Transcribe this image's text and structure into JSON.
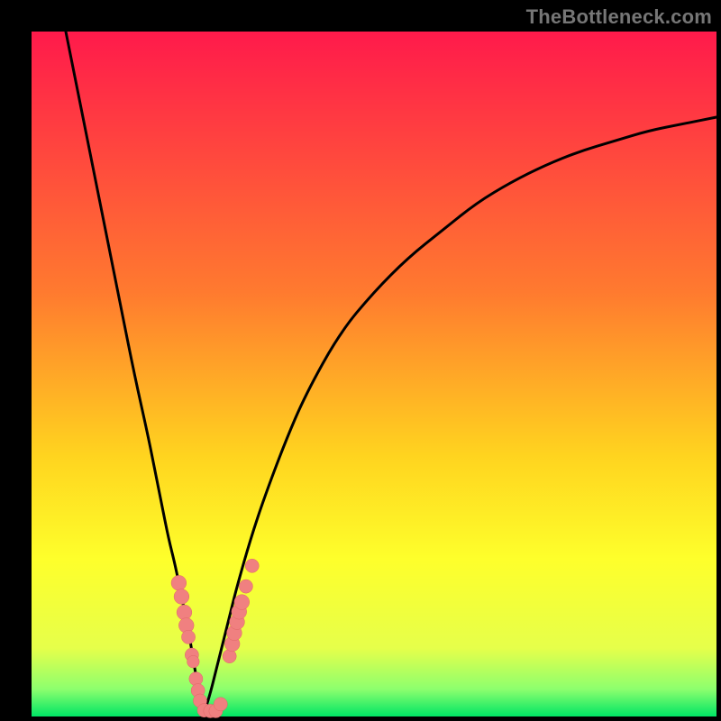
{
  "watermark": "TheBottleneck.com",
  "colors": {
    "frame_bg": "#000000",
    "gradient_stops": [
      {
        "pos": 0,
        "color": "#ff1a4b"
      },
      {
        "pos": 38,
        "color": "#ff7a2f"
      },
      {
        "pos": 62,
        "color": "#ffd41f"
      },
      {
        "pos": 77,
        "color": "#feff2b"
      },
      {
        "pos": 90,
        "color": "#e6ff4a"
      },
      {
        "pos": 96,
        "color": "#8dff6e"
      },
      {
        "pos": 100,
        "color": "#00e565"
      }
    ],
    "curve_stroke": "#000000",
    "marker_fill": "#f08080",
    "marker_stroke": "#e06666"
  },
  "chart_data": {
    "type": "line",
    "title": "",
    "xlabel": "",
    "ylabel": "",
    "xlim": [
      0,
      100
    ],
    "ylim": [
      0,
      100
    ],
    "series": [
      {
        "name": "left-branch",
        "x": [
          5,
          7,
          9,
          11,
          13,
          15,
          17,
          18,
          19,
          20,
          21,
          22,
          23,
          23.5,
          24,
          24.5,
          25
        ],
        "values": [
          100,
          90,
          80,
          70,
          60,
          50,
          41,
          36,
          31,
          26,
          22,
          17,
          12,
          9,
          6,
          3,
          0
        ]
      },
      {
        "name": "right-branch",
        "x": [
          25,
          26,
          27,
          28,
          29,
          30,
          32,
          34,
          37,
          40,
          45,
          50,
          55,
          60,
          65,
          70,
          75,
          80,
          85,
          90,
          95,
          100
        ],
        "values": [
          0,
          3,
          7,
          11,
          15,
          19,
          26,
          32,
          40,
          47,
          56,
          62,
          67,
          71,
          75,
          78,
          80.5,
          82.5,
          84,
          85.5,
          86.5,
          87.5
        ]
      }
    ],
    "annotations": {
      "minimum_x": 25,
      "minimum_value": 0
    },
    "markers": [
      {
        "cx": 21.5,
        "cy": 19.5,
        "r": 1.1
      },
      {
        "cx": 21.9,
        "cy": 17.5,
        "r": 1.1
      },
      {
        "cx": 22.3,
        "cy": 15.2,
        "r": 1.1
      },
      {
        "cx": 22.6,
        "cy": 13.3,
        "r": 1.1
      },
      {
        "cx": 22.9,
        "cy": 11.6,
        "r": 1.0
      },
      {
        "cx": 23.4,
        "cy": 9.0,
        "r": 1.0
      },
      {
        "cx": 23.6,
        "cy": 8.0,
        "r": 0.9
      },
      {
        "cx": 24.0,
        "cy": 5.5,
        "r": 1.0
      },
      {
        "cx": 24.3,
        "cy": 3.8,
        "r": 1.0
      },
      {
        "cx": 24.6,
        "cy": 2.3,
        "r": 1.0
      },
      {
        "cx": 25.2,
        "cy": 0.9,
        "r": 1.0
      },
      {
        "cx": 26.1,
        "cy": 0.8,
        "r": 1.0
      },
      {
        "cx": 26.9,
        "cy": 0.8,
        "r": 1.0
      },
      {
        "cx": 27.6,
        "cy": 1.8,
        "r": 1.0
      },
      {
        "cx": 28.9,
        "cy": 8.8,
        "r": 1.0
      },
      {
        "cx": 29.3,
        "cy": 10.6,
        "r": 1.1
      },
      {
        "cx": 29.6,
        "cy": 12.2,
        "r": 1.1
      },
      {
        "cx": 30.0,
        "cy": 13.8,
        "r": 1.1
      },
      {
        "cx": 30.3,
        "cy": 15.3,
        "r": 1.1
      },
      {
        "cx": 30.7,
        "cy": 16.7,
        "r": 1.1
      },
      {
        "cx": 31.3,
        "cy": 19.0,
        "r": 1.0
      },
      {
        "cx": 32.2,
        "cy": 22.0,
        "r": 1.0
      }
    ]
  }
}
